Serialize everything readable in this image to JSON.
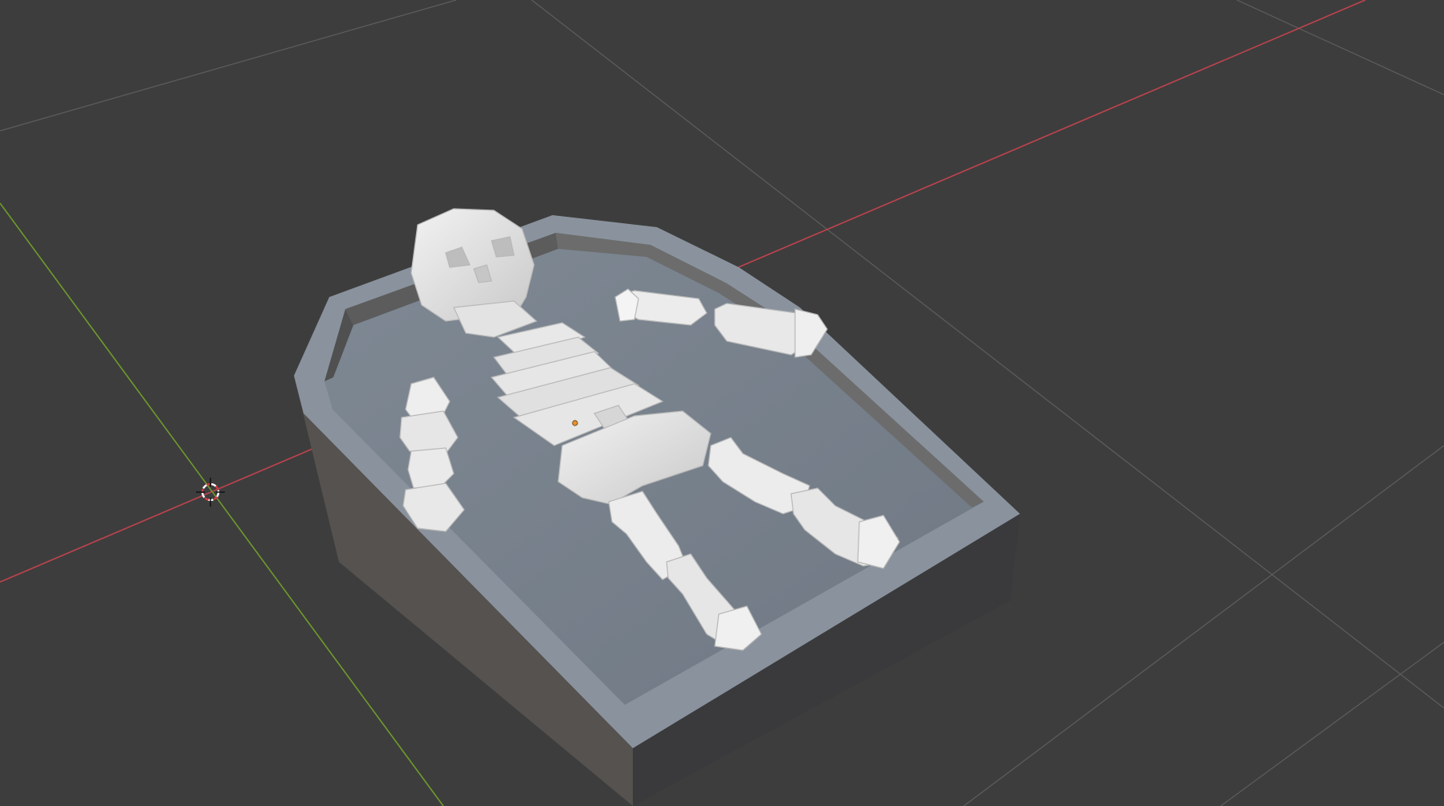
{
  "viewport": {
    "background_color": "#3d3d3d",
    "grid_line_color": "#5e5e5e",
    "x_axis_color": "#c0434e",
    "y_axis_color": "#6f9a2c"
  },
  "scene": {
    "objects": [
      {
        "name": "coffin",
        "color": "#7b8590"
      },
      {
        "name": "skeleton",
        "color": "#e6e6e6"
      }
    ],
    "icons": {
      "cursor": "3d-cursor-icon",
      "origin": "object-origin-icon"
    },
    "origin_color": "#e8912f"
  }
}
